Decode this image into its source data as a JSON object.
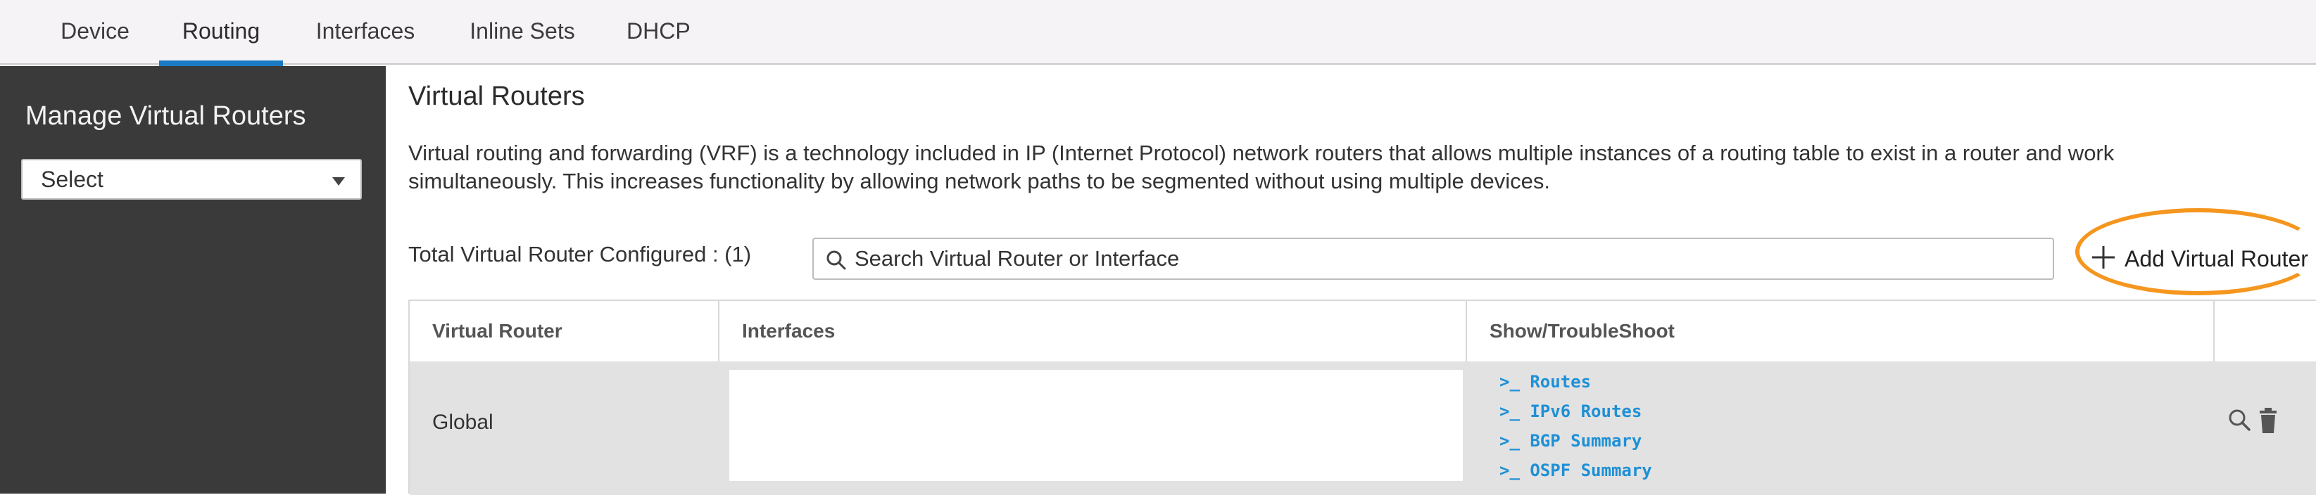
{
  "topnav": {
    "tabs": [
      {
        "label": "Device"
      },
      {
        "label": "Routing",
        "active": true
      },
      {
        "label": "Interfaces"
      },
      {
        "label": "Inline Sets"
      },
      {
        "label": "DHCP"
      }
    ]
  },
  "sidebar": {
    "title": "Manage Virtual Routers",
    "select_value": "Select"
  },
  "main": {
    "title": "Virtual Routers",
    "description": "Virtual routing and forwarding (VRF) is a technology included in IP (Internet Protocol) network routers that allows multiple instances of a routing table to exist in a router and work simultaneously. This increases functionality by allowing network paths to be segmented without using multiple devices.",
    "total_label": "Total Virtual Router Configured : (1)",
    "search_placeholder": "Search Virtual Router or Interface",
    "add_button_label": "Add Virtual Router",
    "highlight_color": "#f5961f",
    "table": {
      "headers": [
        "Virtual Router",
        "Interfaces",
        "Show/TroubleShoot",
        ""
      ],
      "rows": [
        {
          "name": "Global",
          "interfaces": "",
          "links": [
            ">_ Routes",
            ">_ IPv6 Routes",
            ">_ BGP Summary",
            ">_ OSPF Summary"
          ],
          "actions": [
            "search-icon",
            "trash-icon"
          ]
        }
      ]
    }
  },
  "colors": {
    "active_tab_underline": "#1a7bc4",
    "sidebar_bg": "#3a3a3a",
    "link": "#1e90d6",
    "row_bg": "#e2e2e2"
  }
}
